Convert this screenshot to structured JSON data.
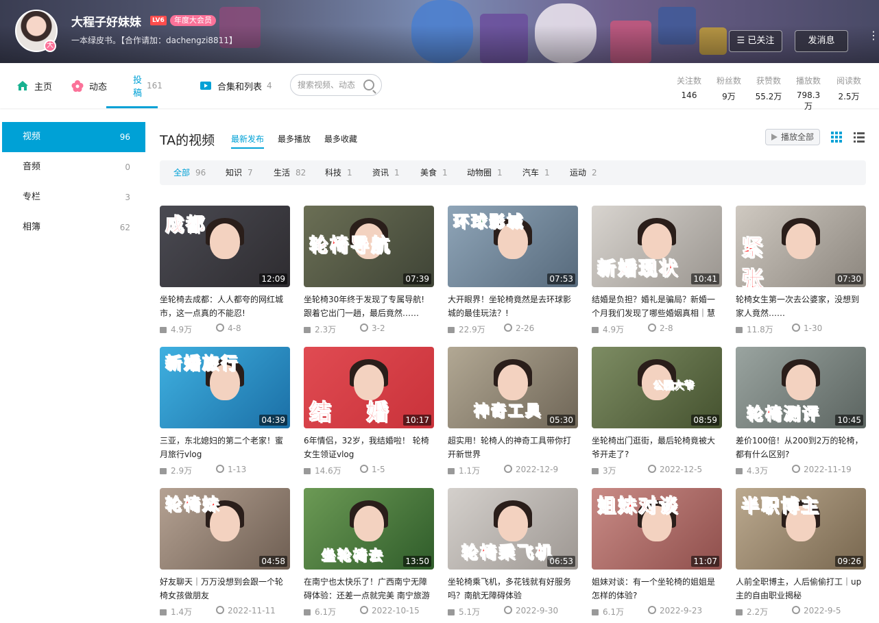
{
  "header": {
    "username": "大程子好妹妹",
    "level": "LV6",
    "vip_badge": "年度大会员",
    "avatar_badge": "大",
    "signature": "一本绿皮书。【合作请加：dachengzi8811】",
    "follow_button": "☰ 已关注",
    "message_button": "发消息"
  },
  "nav": {
    "tabs": [
      {
        "label": "主页",
        "count": ""
      },
      {
        "label": "动态",
        "count": ""
      },
      {
        "label": "投稿",
        "count": "161"
      },
      {
        "label": "合集和列表",
        "count": "4"
      }
    ],
    "search_placeholder": "搜索视频、动态",
    "stats": [
      {
        "label": "关注数",
        "value": "146"
      },
      {
        "label": "粉丝数",
        "value": "9万"
      },
      {
        "label": "获赞数",
        "value": "55.2万"
      },
      {
        "label": "播放数",
        "value": "798.3万"
      },
      {
        "label": "阅读数",
        "value": "2.5万"
      }
    ]
  },
  "sidebar": {
    "items": [
      {
        "label": "视频",
        "count": "96"
      },
      {
        "label": "音频",
        "count": "0"
      },
      {
        "label": "专栏",
        "count": "3"
      },
      {
        "label": "相簿",
        "count": "62"
      }
    ]
  },
  "main": {
    "title": "TA的视频",
    "sort_options": [
      "最新发布",
      "最多播放",
      "最多收藏"
    ],
    "play_all": "播放全部",
    "filters": [
      {
        "label": "全部",
        "count": "96"
      },
      {
        "label": "知识",
        "count": "7"
      },
      {
        "label": "生活",
        "count": "82"
      },
      {
        "label": "科技",
        "count": "1"
      },
      {
        "label": "资讯",
        "count": "1"
      },
      {
        "label": "美食",
        "count": "1"
      },
      {
        "label": "动物圈",
        "count": "1"
      },
      {
        "label": "汽车",
        "count": "1"
      },
      {
        "label": "运动",
        "count": "2"
      }
    ],
    "videos": [
      {
        "caption": "成都",
        "duration": "12:09",
        "title": "坐轮椅去成都：人人都夸的网红城市，这一点真的不能忍!",
        "plays": "4.9万",
        "date": "4-8"
      },
      {
        "caption": "轮椅导航",
        "duration": "07:39",
        "title": "坐轮椅30年终于发现了专属导航! 跟着它出门一趟，最后竟然……",
        "plays": "2.3万",
        "date": "3-2"
      },
      {
        "caption": "环球影城",
        "duration": "07:53",
        "title": "大开眼界！坐轮椅竟然是去环球影城的最佳玩法？!",
        "plays": "22.9万",
        "date": "2-26"
      },
      {
        "caption": "新婚现状",
        "duration": "10:41",
        "title": "结婚是负担？婚礼是骗局？新婚一个月我们发现了哪些婚姻真相｜慧",
        "plays": "4.9万",
        "date": "2-8"
      },
      {
        "caption": "紧 张",
        "duration": "07:30",
        "title": "轮椅女生第一次去公婆家，没想到家人竟然……",
        "plays": "11.8万",
        "date": "1-30"
      },
      {
        "caption": "新婚旅行",
        "duration": "04:39",
        "title": "三亚，东北媳妇的第二个老家！蜜月旅行vlog",
        "plays": "2.9万",
        "date": "1-13"
      },
      {
        "caption": "结 婚",
        "duration": "10:17",
        "title": "6年情侣，32岁，我结婚啦！ 轮椅女生领证vlog",
        "plays": "14.6万",
        "date": "1-5"
      },
      {
        "caption": "神奇工具",
        "duration": "05:30",
        "title": "超实用！轮椅人的神奇工具带你打开新世界",
        "plays": "1.1万",
        "date": "2022-12-9"
      },
      {
        "caption": "公园大爷",
        "duration": "08:59",
        "title": "坐轮椅出门逛街，最后轮椅竟被大爷开走了?",
        "plays": "3万",
        "date": "2022-12-5"
      },
      {
        "caption": "轮椅测评",
        "duration": "10:45",
        "title": "差价100倍！从200到2万的轮椅，都有什么区别?",
        "plays": "4.3万",
        "date": "2022-11-19"
      },
      {
        "caption": "轮椅妹",
        "duration": "04:58",
        "title": "好友聊天｜万万没想到会跟一个轮椅女孩做朋友",
        "plays": "1.4万",
        "date": "2022-11-11"
      },
      {
        "caption": "坐轮椅去",
        "duration": "13:50",
        "title": "在南宁也太快乐了！广西南宁无障碍体验：还差一点就完美 南宁旅游",
        "plays": "6.1万",
        "date": "2022-10-15"
      },
      {
        "caption": "轮椅乘飞机",
        "duration": "06:53",
        "title": "坐轮椅乘飞机，多花钱就有好服务吗？南航无障碍体验",
        "plays": "5.1万",
        "date": "2022-9-30"
      },
      {
        "caption": "姐妹对谈",
        "duration": "11:07",
        "title": "姐妹对谈：有一个坐轮椅的姐姐是怎样的体验?",
        "plays": "6.1万",
        "date": "2022-9-23"
      },
      {
        "caption": "半职博主",
        "duration": "09:26",
        "title": "人前全职博主，人后偷偷打工｜up主的自由职业揭秘",
        "plays": "2.2万",
        "date": "2022-9-5"
      }
    ]
  },
  "colors": {
    "accent": "#00a1d6",
    "pink": "#fb7299"
  }
}
